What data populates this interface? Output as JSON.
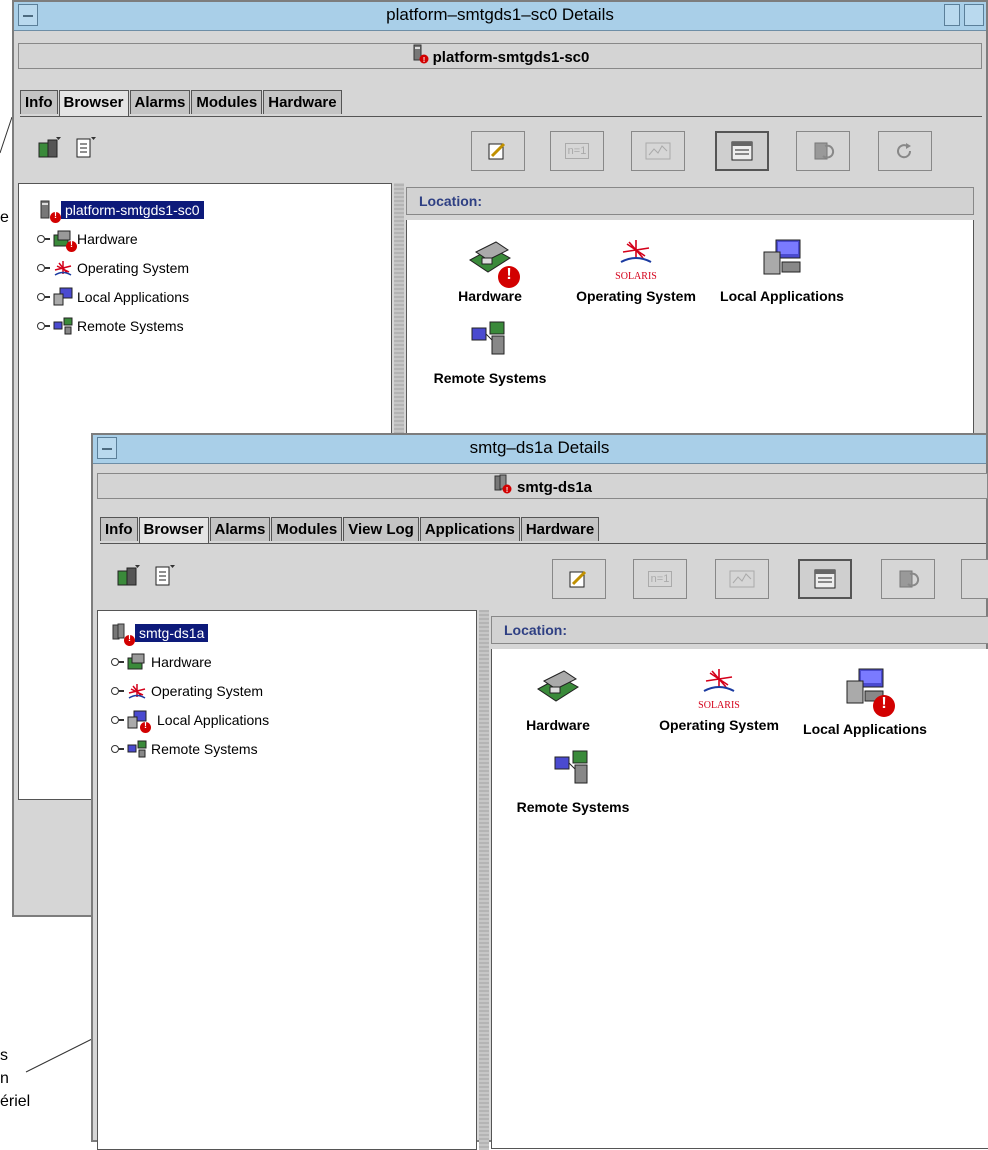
{
  "window1": {
    "title": "platform–smtgds1–sc0 Details",
    "host": "platform-smtgds1-sc0",
    "tabs": [
      "Info",
      "Browser",
      "Alarms",
      "Modules",
      "Hardware"
    ],
    "active_tab": "Browser",
    "tree": {
      "root": "platform-smtgds1-sc0",
      "items": [
        "Hardware",
        "Operating System",
        "Local Applications",
        "Remote Systems"
      ]
    },
    "location_label": "Location:",
    "content": [
      "Hardware",
      "Operating System",
      "Local Applications",
      "Remote Systems"
    ]
  },
  "window2": {
    "title": "smtg–ds1a Details",
    "host": "smtg-ds1a",
    "tabs": [
      "Info",
      "Browser",
      "Alarms",
      "Modules",
      "View Log",
      "Applications",
      "Hardware"
    ],
    "active_tab": "Browser",
    "tree": {
      "root": "smtg-ds1a",
      "items": [
        "Hardware",
        "Operating System",
        "Local Applications",
        "Remote Systems"
      ]
    },
    "location_label": "Location:",
    "content": [
      "Hardware",
      "Operating System",
      "Local Applications",
      "Remote Systems"
    ]
  },
  "toolbar": {
    "n1_label": "n=1"
  },
  "solaris_label": "SOLARIS",
  "callouts": {
    "c1": "e",
    "c2": [
      "s",
      "n",
      "ériel"
    ]
  },
  "icons": {
    "alarm_badge": "alarm-badge-icon"
  },
  "colors": {
    "titlebar": "#a9cfe8",
    "selection": "#0d1a7a",
    "alarm": "#d20000",
    "location_text": "#2e3f83"
  }
}
